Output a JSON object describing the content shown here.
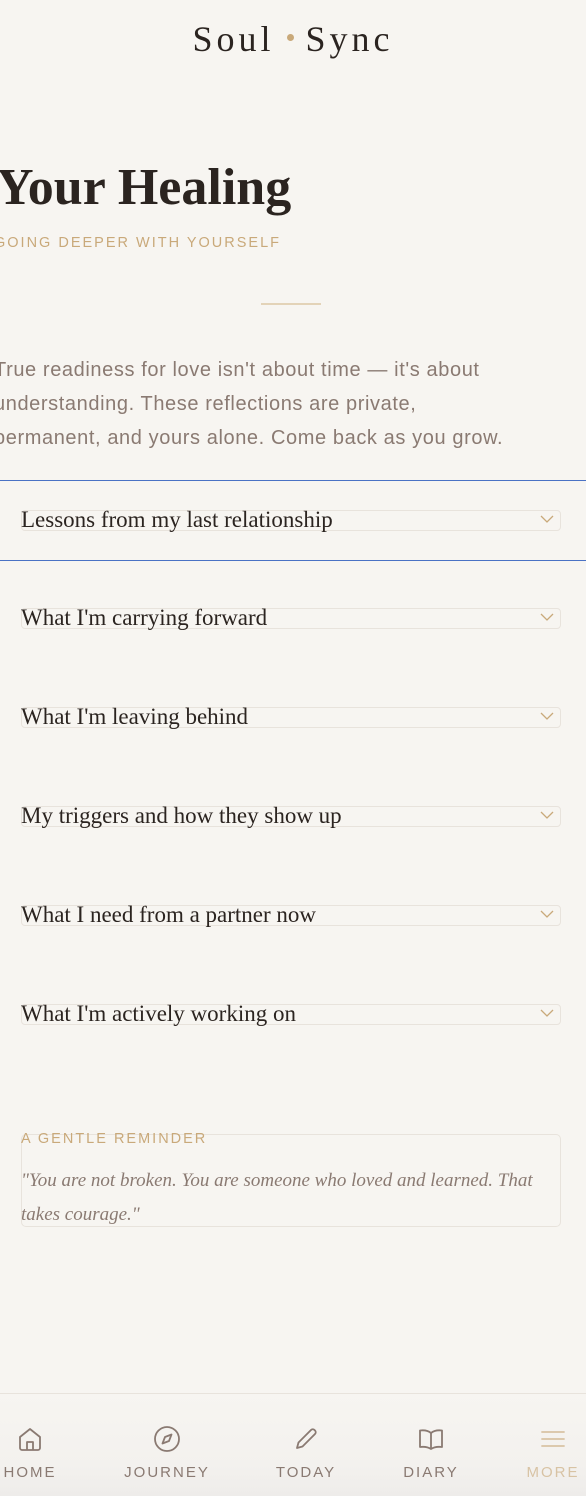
{
  "header": {
    "brand_left": "Soul",
    "brand_right": "Sync"
  },
  "hero": {
    "title": "Your Healing",
    "subtitle": "GOING DEEPER WITH YOURSELF",
    "intro_lines": [
      "True readiness for love isn't about time — it's about",
      "understanding. These reflections are private,",
      "permanent, and yours alone. Come back as you grow."
    ]
  },
  "accordion": {
    "items": [
      {
        "label": "Lessons from my last relationship"
      },
      {
        "label": "What I'm carrying forward"
      },
      {
        "label": "What I'm leaving behind"
      },
      {
        "label": "My triggers and how they show up"
      },
      {
        "label": "What I need from a partner now"
      },
      {
        "label": "What I'm actively working on"
      }
    ]
  },
  "reminder": {
    "label": "A GENTLE REMINDER",
    "quote": "\"You are not broken. You are someone who loved and learned. That takes courage.\""
  },
  "nav": {
    "items": [
      {
        "label": "HOME",
        "icon": "home-icon"
      },
      {
        "label": "JOURNEY",
        "icon": "compass-icon"
      },
      {
        "label": "TODAY",
        "icon": "pencil-icon"
      },
      {
        "label": "DIARY",
        "icon": "book-icon"
      },
      {
        "label": "MORE",
        "icon": "menu-icon"
      }
    ]
  },
  "colors": {
    "background": "#f7f5f1",
    "text": "#2b2420",
    "muted": "#8a7a72",
    "gold": "#c9a97a",
    "focus": "#4a72c4"
  }
}
